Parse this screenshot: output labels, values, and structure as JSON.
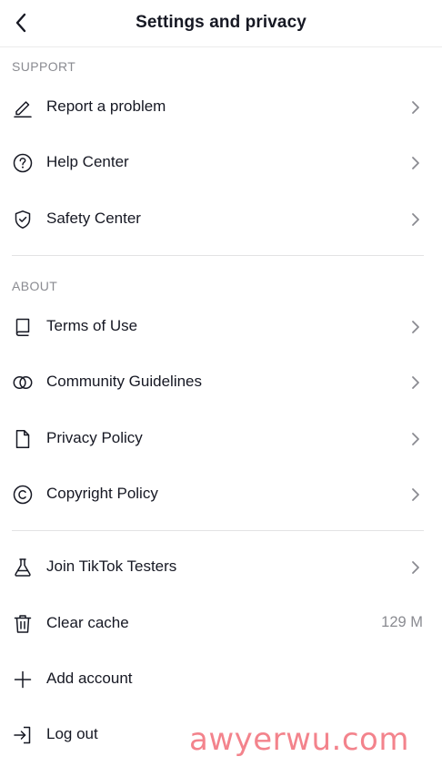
{
  "header": {
    "title": "Settings and privacy",
    "back_icon": "chevron-left-icon"
  },
  "sections": {
    "support": {
      "label": "SUPPORT",
      "items": [
        {
          "label": "Report a problem",
          "icon": "pencil-icon"
        },
        {
          "label": "Help Center",
          "icon": "question-circle-icon"
        },
        {
          "label": "Safety Center",
          "icon": "shield-check-icon"
        }
      ]
    },
    "about": {
      "label": "ABOUT",
      "items": [
        {
          "label": "Terms of Use",
          "icon": "book-icon"
        },
        {
          "label": "Community Guidelines",
          "icon": "linked-circles-icon"
        },
        {
          "label": "Privacy Policy",
          "icon": "document-icon"
        },
        {
          "label": "Copyright Policy",
          "icon": "copyright-icon"
        }
      ]
    },
    "other": {
      "items": [
        {
          "label": "Join TikTok Testers",
          "icon": "flask-icon"
        },
        {
          "label": "Clear cache",
          "icon": "trash-icon",
          "value": "129 M"
        },
        {
          "label": "Add account",
          "icon": "plus-icon"
        },
        {
          "label": "Log out",
          "icon": "logout-icon"
        }
      ]
    }
  },
  "watermark": "awyerwu.com",
  "colors": {
    "text": "#161823",
    "secondary": "#8a8b91",
    "divider": "#e3e3e4",
    "watermark": "#f0606c"
  }
}
